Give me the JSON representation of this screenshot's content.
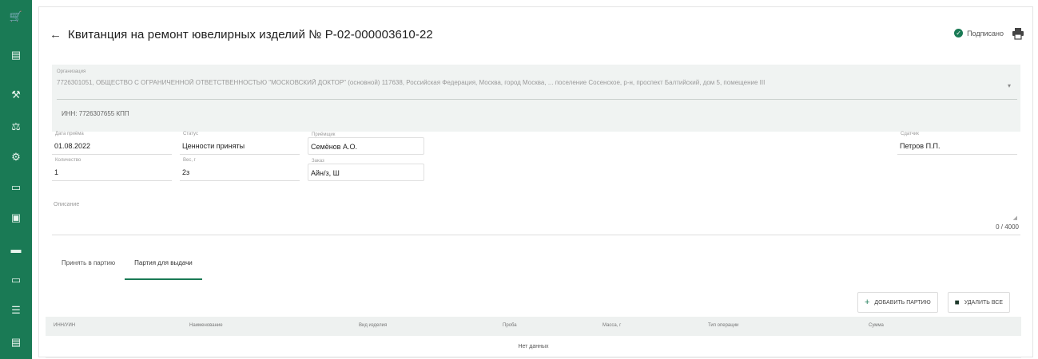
{
  "sidebar": {
    "items": [
      {
        "icon": "cart-icon",
        "glyph": "🛒"
      },
      {
        "icon": "document-icon",
        "glyph": "▤"
      },
      {
        "icon": "tools-icon",
        "glyph": "⚒"
      },
      {
        "icon": "scale-icon",
        "glyph": "⚖"
      },
      {
        "icon": "gear-box-icon",
        "glyph": "⚙"
      },
      {
        "icon": "card-icon",
        "glyph": "▭"
      },
      {
        "icon": "file-icon",
        "glyph": "▣"
      },
      {
        "icon": "briefcase-icon",
        "glyph": "▬"
      },
      {
        "icon": "monitor-icon",
        "glyph": "▭"
      },
      {
        "icon": "list-icon",
        "glyph": "☰"
      },
      {
        "icon": "id-card-icon",
        "glyph": "▤"
      }
    ],
    "color": "#1a7a55"
  },
  "header": {
    "back": "←",
    "title": "Квитанция на ремонт ювелирных изделий № Р-02-000003610-22",
    "status_label": "Подписано",
    "status_color": "#1a7a55"
  },
  "organization": {
    "label": "Организация",
    "value": "7726301051, ОБЩЕСТВО С ОГРАНИЧЕННОЙ ОТВЕТСТВЕННОСТЬЮ \"МОСКОВСКИЙ ДОКТОР\" (основной) 117638, Российская Федерация, Москва, город Москва, ... поселение Сосенское, р-н, проспект Балтийский, дом 5, помещение III",
    "inn": "ИНН: 7726307655 КПП"
  },
  "fields": {
    "date": {
      "label": "Дата приёма",
      "value": "01.08.2022"
    },
    "status": {
      "label": "Статус",
      "value": "Ценности приняты"
    },
    "receiver": {
      "label": "Приёмщик",
      "value": "Семёнов А.О."
    },
    "client": {
      "label": "Сдатчик",
      "value": "Петров П.П."
    },
    "number": {
      "label": "Количество",
      "value": "1"
    },
    "weight": {
      "label": "Вес, г",
      "value": "2з"
    },
    "order": {
      "label": "Заказ",
      "value": "Айн/з, Ш"
    }
  },
  "comment": {
    "label": "Описание",
    "counter": "0 / 4000"
  },
  "tabs": [
    {
      "label": "Принять в партию"
    },
    {
      "label": "Партия для выдачи"
    }
  ],
  "actions": {
    "add": "ДОБАВИТЬ ПАРТИЮ",
    "delete": "УДАЛИТЬ ВСЕ"
  },
  "table": {
    "columns": [
      "ИНН/УИН",
      "Наименование",
      "Вид изделия",
      "Проба",
      "Масса, г",
      "Тип операции",
      "Сумма"
    ],
    "empty": "Нет данных"
  }
}
